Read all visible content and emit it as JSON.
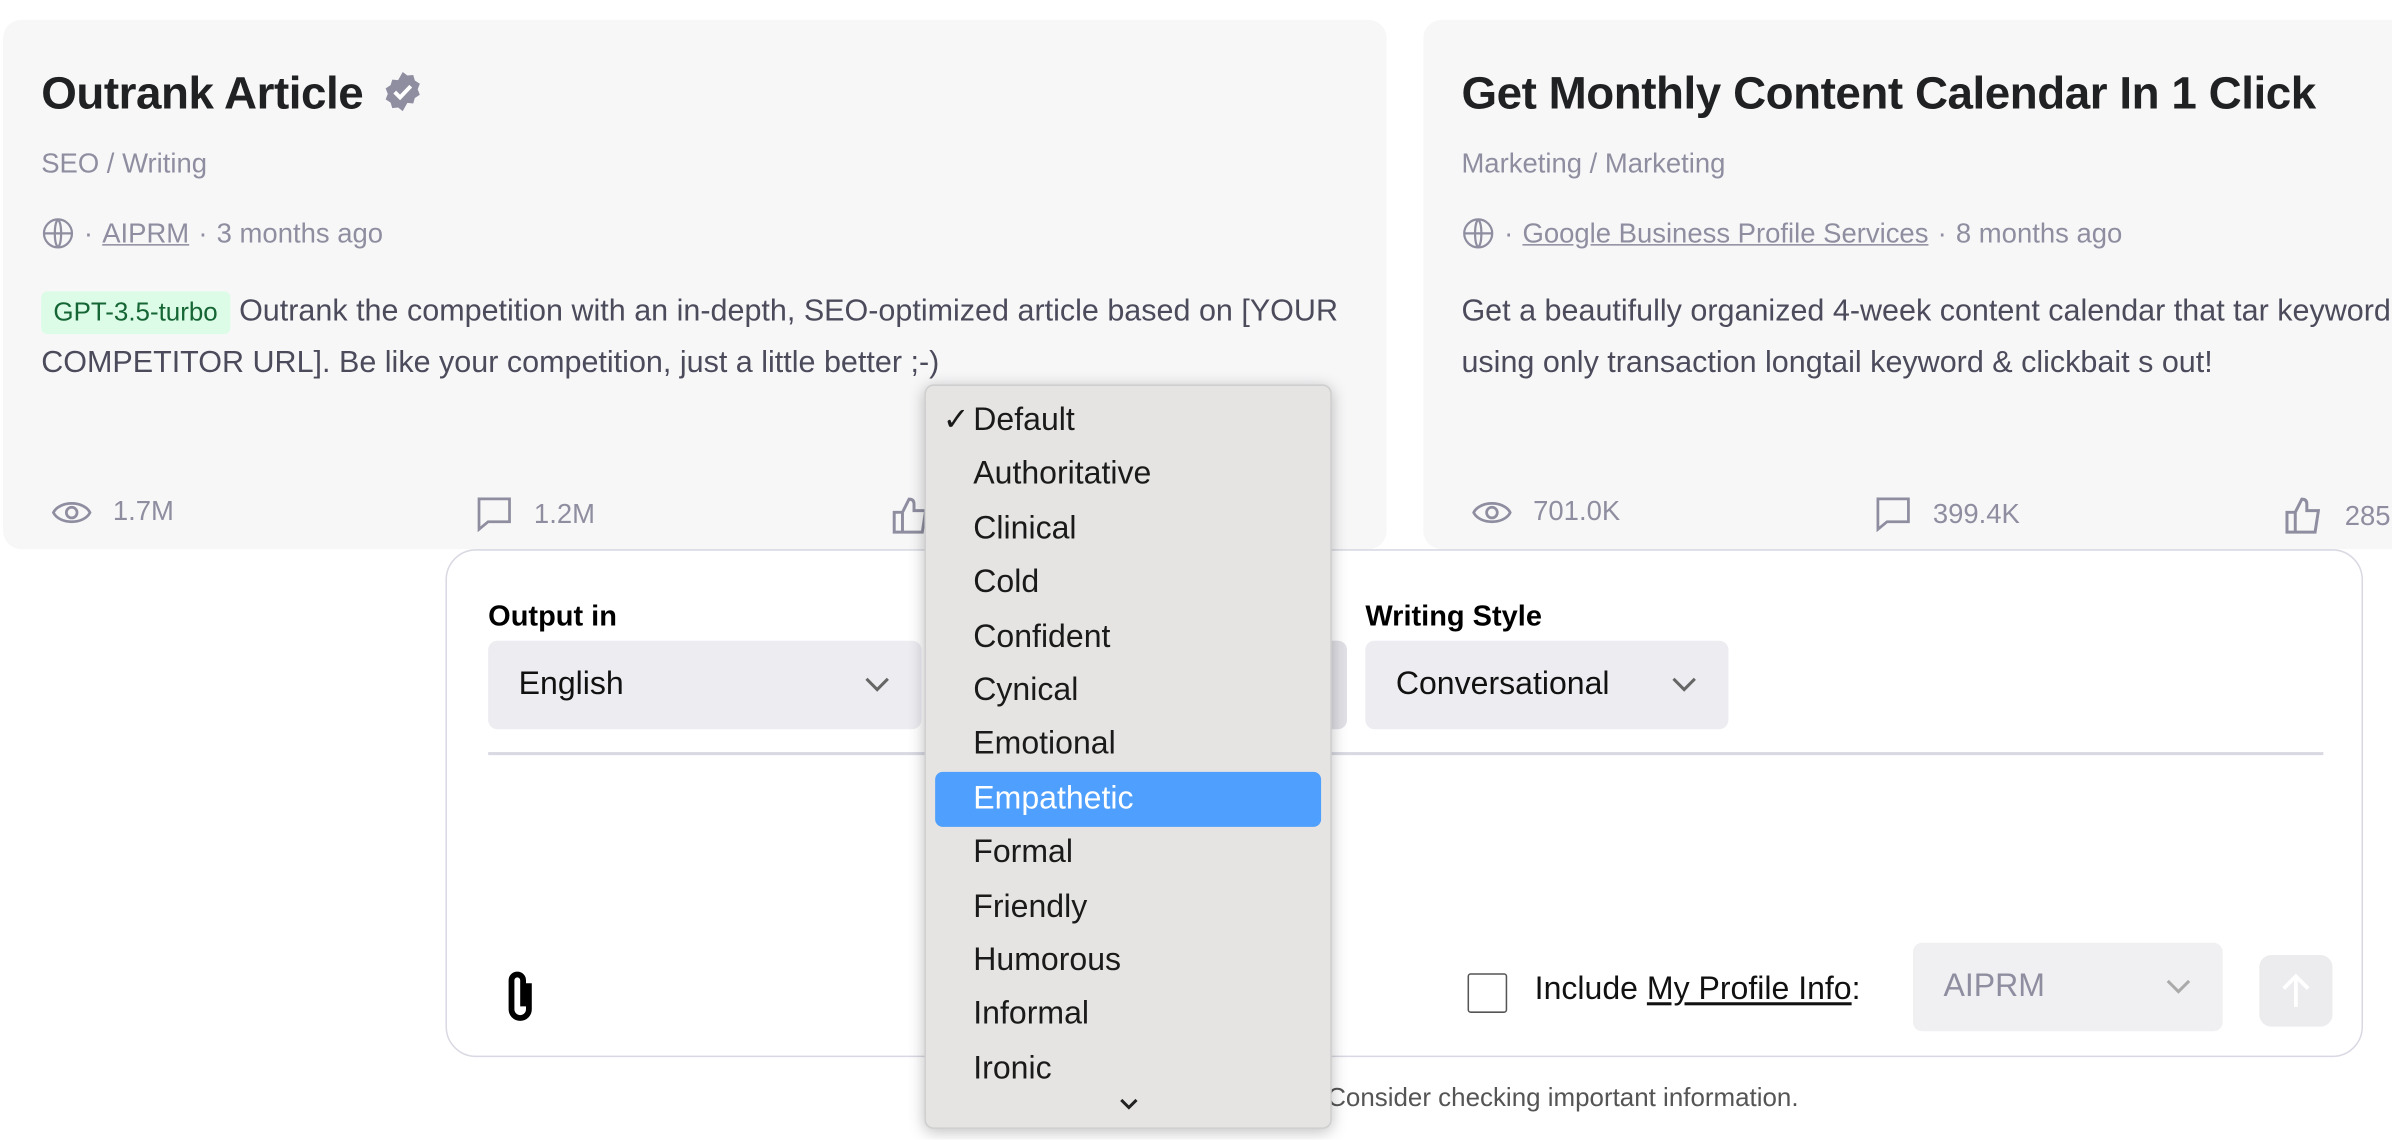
{
  "cards": [
    {
      "title": "Outrank Article",
      "verified": true,
      "category": "SEO / Writing",
      "author": "AIPRM",
      "time": "3 months ago",
      "model_badge": "GPT-3.5-turbo",
      "description": "Outrank the competition with an in-depth, SEO-optimized article based on [YOUR COMPETITOR URL]. Be like your competition, just a little better ;-)",
      "views": "1.7M",
      "comments": "1.2M"
    },
    {
      "title": "Get Monthly Content Calendar In 1 Click",
      "category": "Marketing / Marketing",
      "author": "Google Business Profile Services",
      "time": "8 months ago",
      "description": "Get a beautifully organized 4-week content calendar that tar keyword using only transaction longtail keyword & clickbait s out!",
      "views": "701.0K",
      "comments": "399.4K",
      "likes": "285"
    }
  ],
  "panel": {
    "output_label": "Output in",
    "output_value": "English",
    "style_label": "Writing Style",
    "style_value": "Conversational",
    "include_prefix": "Include ",
    "profile_link": "My Profile Info",
    "include_suffix": ":",
    "profile_value": "AIPRM",
    "include_checked": false
  },
  "tone_dropdown": {
    "selected": "Default",
    "highlighted": "Empathetic",
    "check": "✓",
    "options": [
      "Default",
      "Authoritative",
      "Clinical",
      "Cold",
      "Confident",
      "Cynical",
      "Emotional",
      "Empathetic",
      "Formal",
      "Friendly",
      "Humorous",
      "Informal",
      "Ironic"
    ]
  },
  "footer": "Consider checking important information.",
  "colors": {
    "highlight": "#4f9ffe",
    "badge_bg": "#dcfce7",
    "badge_text": "#166534"
  }
}
